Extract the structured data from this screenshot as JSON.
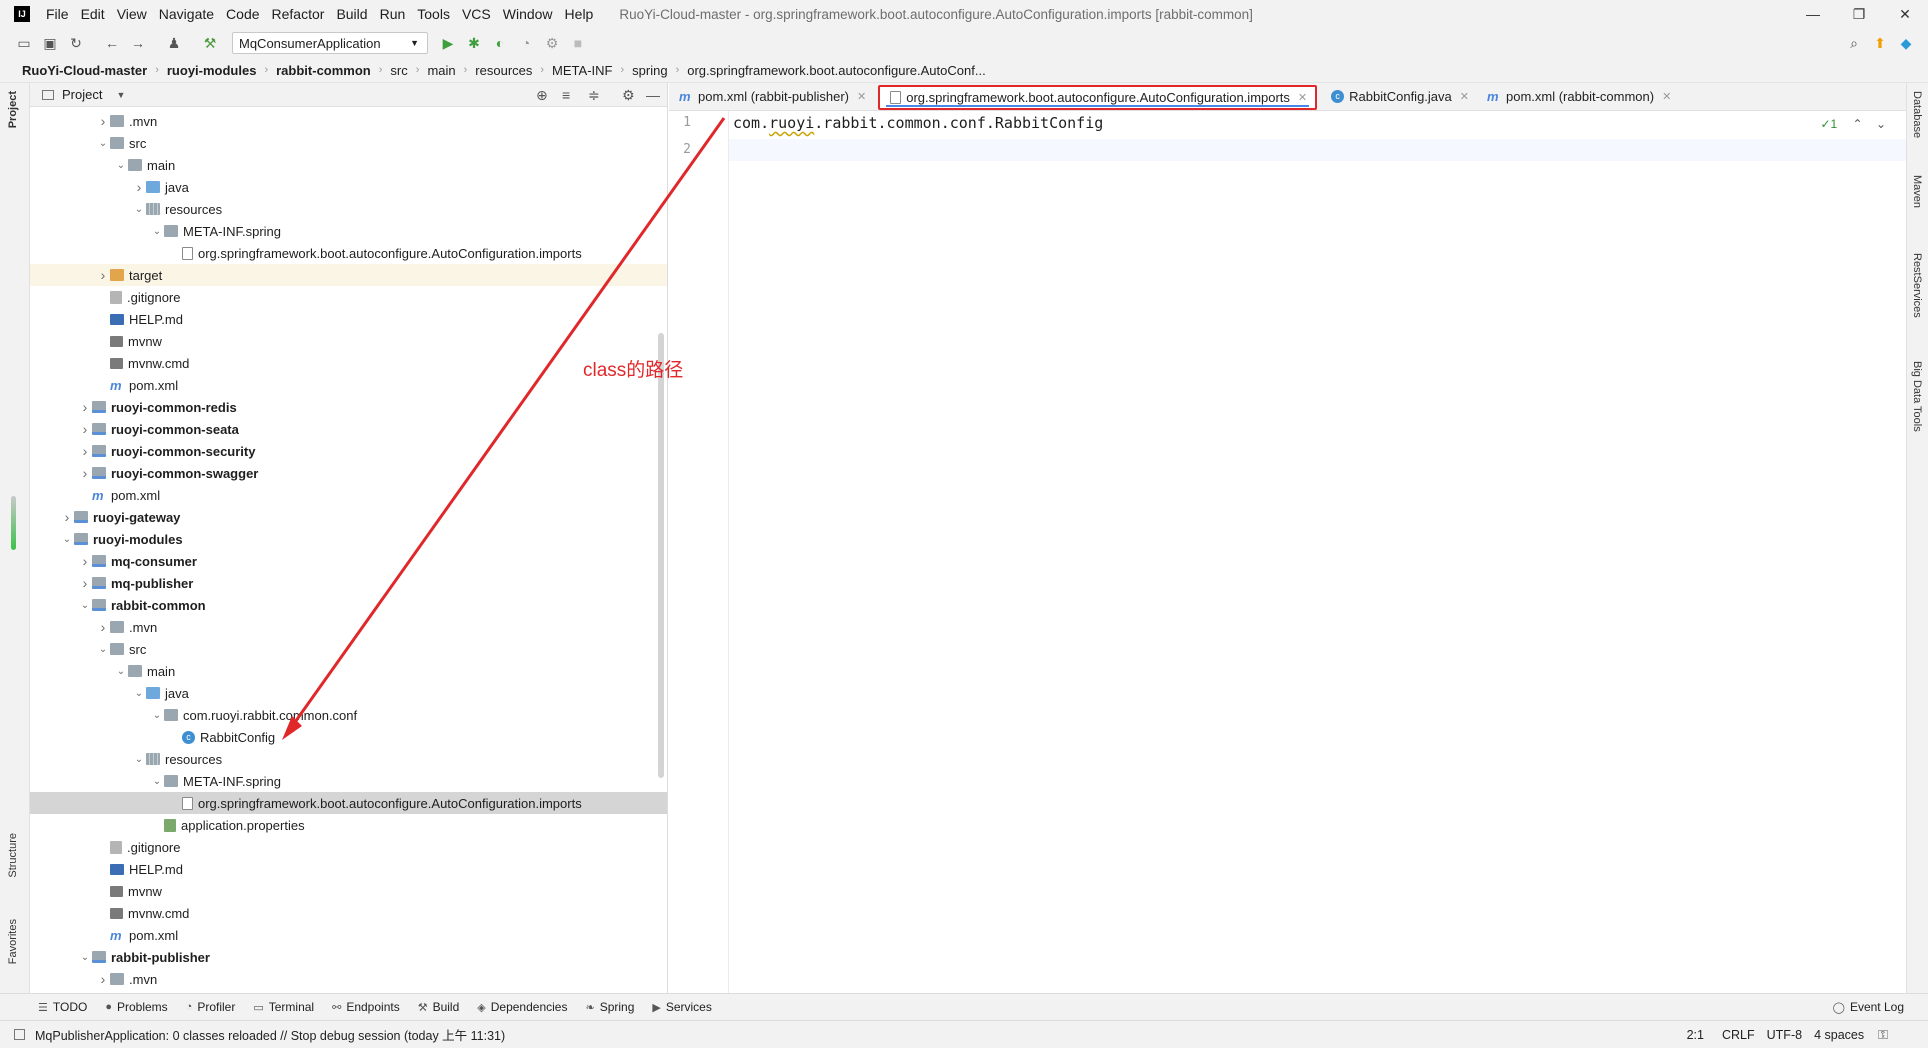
{
  "menu": {
    "items": [
      "File",
      "Edit",
      "View",
      "Navigate",
      "Code",
      "Refactor",
      "Build",
      "Run",
      "Tools",
      "VCS",
      "Window",
      "Help"
    ],
    "title": "RuoYi-Cloud-master - org.springframework.boot.autoconfigure.AutoConfiguration.imports [rabbit-common]"
  },
  "toolbar": {
    "run_config": "MqConsumerApplication"
  },
  "breadcrumb": [
    "RuoYi-Cloud-master",
    "ruoyi-modules",
    "rabbit-common",
    "src",
    "main",
    "resources",
    "META-INF",
    "spring",
    "org.springframework.boot.autoconfigure.AutoConf..."
  ],
  "left_strip": {
    "project": "Project",
    "structure": "Structure",
    "favorites": "Favorites"
  },
  "right_strip": {
    "database": "Database",
    "maven": "Maven",
    "rest": "RestServices",
    "bigdata": "Big Data Tools"
  },
  "project_panel": {
    "title": "Project",
    "tree": [
      {
        "label": ".mvn",
        "indent": 3,
        "arrow": "right",
        "icon": "folder"
      },
      {
        "label": "src",
        "indent": 3,
        "arrow": "down",
        "icon": "src"
      },
      {
        "label": "main",
        "indent": 4,
        "arrow": "down",
        "icon": "folder"
      },
      {
        "label": "java",
        "indent": 5,
        "arrow": "right",
        "icon": "java"
      },
      {
        "label": "resources",
        "indent": 5,
        "arrow": "down",
        "icon": "res"
      },
      {
        "label": "META-INF.spring",
        "indent": 6,
        "arrow": "down",
        "icon": "folder"
      },
      {
        "label": "org.springframework.boot.autoconfigure.AutoConfiguration.imports",
        "indent": 7,
        "arrow": "",
        "icon": "file"
      },
      {
        "label": "target",
        "indent": 3,
        "arrow": "right",
        "icon": "orange",
        "style": "target"
      },
      {
        "label": ".gitignore",
        "indent": 3,
        "arrow": "",
        "icon": "git"
      },
      {
        "label": "HELP.md",
        "indent": 3,
        "arrow": "",
        "icon": "md"
      },
      {
        "label": "mvnw",
        "indent": 3,
        "arrow": "",
        "icon": "term"
      },
      {
        "label": "mvnw.cmd",
        "indent": 3,
        "arrow": "",
        "icon": "term"
      },
      {
        "label": "pom.xml",
        "indent": 3,
        "arrow": "",
        "icon": "m"
      },
      {
        "label": "ruoyi-common-redis",
        "indent": 2,
        "arrow": "right",
        "icon": "module",
        "bold": true
      },
      {
        "label": "ruoyi-common-seata",
        "indent": 2,
        "arrow": "right",
        "icon": "module",
        "bold": true
      },
      {
        "label": "ruoyi-common-security",
        "indent": 2,
        "arrow": "right",
        "icon": "module",
        "bold": true
      },
      {
        "label": "ruoyi-common-swagger",
        "indent": 2,
        "arrow": "right",
        "icon": "module",
        "bold": true
      },
      {
        "label": "pom.xml",
        "indent": 2,
        "arrow": "",
        "icon": "m"
      },
      {
        "label": "ruoyi-gateway",
        "indent": 1,
        "arrow": "right",
        "icon": "module",
        "bold": true
      },
      {
        "label": "ruoyi-modules",
        "indent": 1,
        "arrow": "down",
        "icon": "module",
        "bold": true
      },
      {
        "label": "mq-consumer",
        "indent": 2,
        "arrow": "right",
        "icon": "module",
        "bold": true
      },
      {
        "label": "mq-publisher",
        "indent": 2,
        "arrow": "right",
        "icon": "module",
        "bold": true
      },
      {
        "label": "rabbit-common",
        "indent": 2,
        "arrow": "down",
        "icon": "module",
        "bold": true
      },
      {
        "label": ".mvn",
        "indent": 3,
        "arrow": "right",
        "icon": "folder"
      },
      {
        "label": "src",
        "indent": 3,
        "arrow": "down",
        "icon": "src"
      },
      {
        "label": "main",
        "indent": 4,
        "arrow": "down",
        "icon": "folder"
      },
      {
        "label": "java",
        "indent": 5,
        "arrow": "down",
        "icon": "java"
      },
      {
        "label": "com.ruoyi.rabbit.common.conf",
        "indent": 6,
        "arrow": "down",
        "icon": "folder"
      },
      {
        "label": "RabbitConfig",
        "indent": 7,
        "arrow": "",
        "icon": "c"
      },
      {
        "label": "resources",
        "indent": 5,
        "arrow": "down",
        "icon": "res"
      },
      {
        "label": "META-INF.spring",
        "indent": 6,
        "arrow": "down",
        "icon": "folder"
      },
      {
        "label": "org.springframework.boot.autoconfigure.AutoConfiguration.imports",
        "indent": 7,
        "arrow": "",
        "icon": "file",
        "style": "selected"
      },
      {
        "label": "application.properties",
        "indent": 6,
        "arrow": "",
        "icon": "props"
      },
      {
        "label": ".gitignore",
        "indent": 3,
        "arrow": "",
        "icon": "git"
      },
      {
        "label": "HELP.md",
        "indent": 3,
        "arrow": "",
        "icon": "md"
      },
      {
        "label": "mvnw",
        "indent": 3,
        "arrow": "",
        "icon": "term"
      },
      {
        "label": "mvnw.cmd",
        "indent": 3,
        "arrow": "",
        "icon": "term"
      },
      {
        "label": "pom.xml",
        "indent": 3,
        "arrow": "",
        "icon": "m"
      },
      {
        "label": "rabbit-publisher",
        "indent": 2,
        "arrow": "down",
        "icon": "module",
        "bold": true
      },
      {
        "label": ".mvn",
        "indent": 3,
        "arrow": "right",
        "icon": "folder"
      }
    ]
  },
  "editor": {
    "tabs": [
      {
        "label": "pom.xml (rabbit-publisher)",
        "icon": "m"
      },
      {
        "label": "org.springframework.boot.autoconfigure.AutoConfiguration.imports",
        "icon": "file",
        "active": true
      },
      {
        "label": "RabbitConfig.java",
        "icon": "c"
      },
      {
        "label": "pom.xml (rabbit-common)",
        "icon": "m"
      }
    ],
    "line_numbers": [
      "1",
      "2"
    ],
    "code": {
      "prefix": "com.",
      "squiggle": "ruoyi",
      "suffix": ".rabbit.common.conf.RabbitConfig"
    },
    "inspection": "✓1"
  },
  "annotation": {
    "text": "class的路径",
    "color": "#e0282b"
  },
  "bottom_tools": [
    "TODO",
    "Problems",
    "Profiler",
    "Terminal",
    "Endpoints",
    "Build",
    "Dependencies",
    "Spring",
    "Services"
  ],
  "event_log": "Event Log",
  "status": {
    "message": "MqPublisherApplication: 0 classes reloaded // Stop debug session (today 上午 11:31)",
    "position": "2:1",
    "line_sep": "CRLF",
    "encoding": "UTF-8",
    "indent": "4 spaces"
  }
}
